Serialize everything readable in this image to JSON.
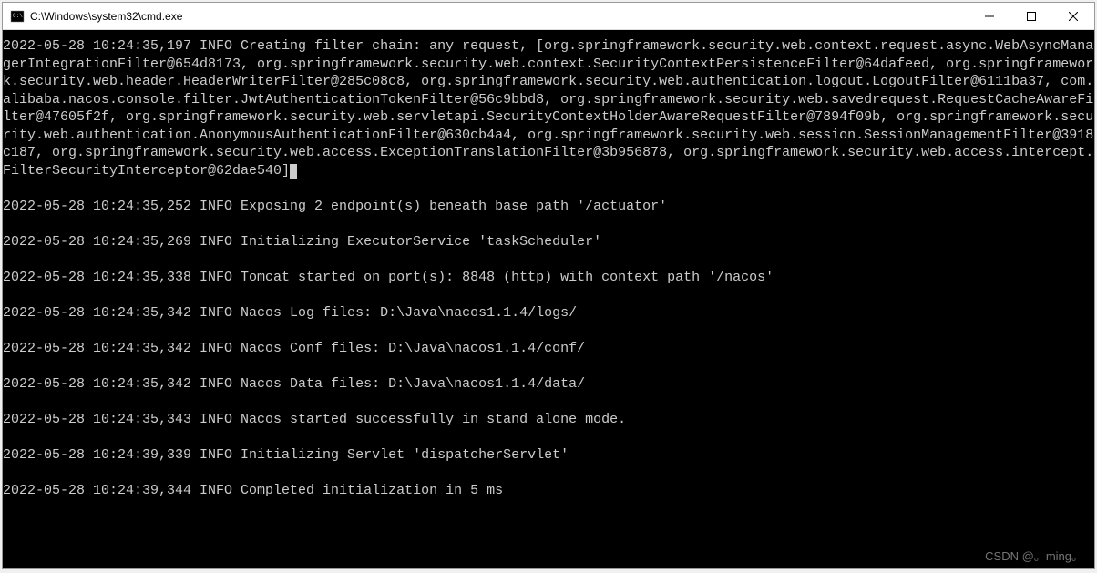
{
  "window": {
    "title": "C:\\Windows\\system32\\cmd.exe"
  },
  "logs": [
    "2022-05-28 10:24:35,197 INFO Creating filter chain: any request, [org.springframework.security.web.context.request.async.WebAsyncManagerIntegrationFilter@654d8173, org.springframework.security.web.context.SecurityContextPersistenceFilter@64dafeed, org.springframework.security.web.header.HeaderWriterFilter@285c08c8, org.springframework.security.web.authentication.logout.LogoutFilter@6111ba37, com.alibaba.nacos.console.filter.JwtAuthenticationTokenFilter@56c9bbd8, org.springframework.security.web.savedrequest.RequestCacheAwareFilter@47605f2f, org.springframework.security.web.servletapi.SecurityContextHolderAwareRequestFilter@7894f09b, org.springframework.security.web.authentication.AnonymousAuthenticationFilter@630cb4a4, org.springframework.security.web.session.SessionManagementFilter@3918c187, org.springframework.security.web.access.ExceptionTranslationFilter@3b956878, org.springframework.security.web.access.intercept.FilterSecurityInterceptor@62dae540]",
    "2022-05-28 10:24:35,252 INFO Exposing 2 endpoint(s) beneath base path '/actuator'",
    "2022-05-28 10:24:35,269 INFO Initializing ExecutorService 'taskScheduler'",
    "2022-05-28 10:24:35,338 INFO Tomcat started on port(s): 8848 (http) with context path '/nacos'",
    "2022-05-28 10:24:35,342 INFO Nacos Log files: D:\\Java\\nacos1.1.4/logs/",
    "2022-05-28 10:24:35,342 INFO Nacos Conf files: D:\\Java\\nacos1.1.4/conf/",
    "2022-05-28 10:24:35,342 INFO Nacos Data files: D:\\Java\\nacos1.1.4/data/",
    "2022-05-28 10:24:35,343 INFO Nacos started successfully in stand alone mode.",
    "2022-05-28 10:24:39,339 INFO Initializing Servlet 'dispatcherServlet'",
    "2022-05-28 10:24:39,344 INFO Completed initialization in 5 ms"
  ],
  "watermark": "CSDN @。ming。"
}
